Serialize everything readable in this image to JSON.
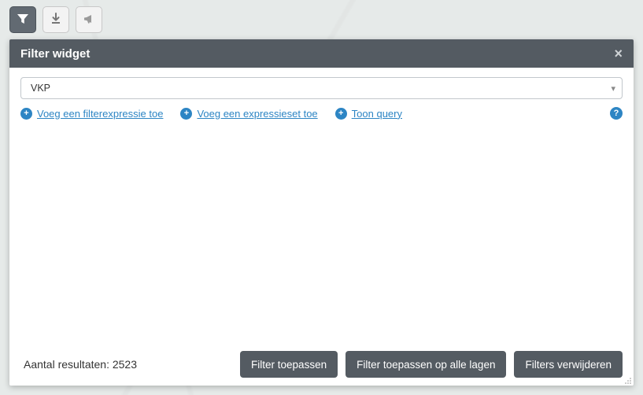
{
  "toolbar": {
    "buttons": [
      {
        "name": "filter-tool-button",
        "active": true,
        "icon": "funnel-icon"
      },
      {
        "name": "download-tool-button",
        "active": false,
        "icon": "download-icon"
      },
      {
        "name": "announce-tool-button",
        "active": false,
        "icon": "megaphone-icon"
      }
    ]
  },
  "panel": {
    "title": "Filter widget",
    "close_label": "×",
    "layer_select": {
      "value": "VKP"
    },
    "links": {
      "add_expression": "Voeg een filterexpressie toe",
      "add_set": "Voeg een expressieset toe",
      "show_query": "Toon query"
    },
    "results_prefix": "Aantal resultaten: ",
    "results_count": "2523",
    "buttons": {
      "apply": "Filter toepassen",
      "apply_all": "Filter toepassen op alle lagen",
      "clear": "Filters verwijderen"
    }
  }
}
